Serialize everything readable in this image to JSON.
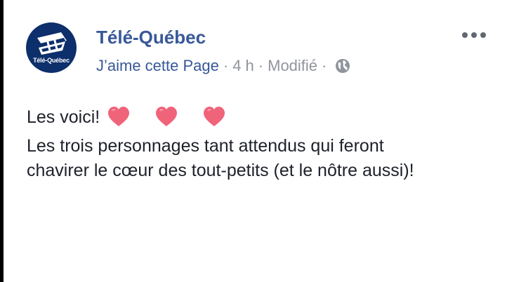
{
  "post": {
    "page_name": "Télé-Québec",
    "avatar": {
      "logo_text": "Télé-Québec",
      "background": "#0d2f6b"
    },
    "meta": {
      "like_label": "J’aime cette Page",
      "separator": "·",
      "time": "4 h",
      "edited": "Modifié",
      "privacy_icon": "globe-icon"
    },
    "more_icon": "more-options-icon",
    "body": {
      "line1": "Les voici!",
      "emoji": [
        "heart-icon",
        "heart-icon",
        "heart-icon"
      ],
      "line2": "Les trois personnages tant attendus qui feront",
      "line3": "chavirer le cœur des tout-petits (et le nôtre aussi)!"
    }
  },
  "colors": {
    "link": "#385898",
    "meta": "#90949c",
    "text": "#1d2129",
    "heart": "#f0647a"
  }
}
